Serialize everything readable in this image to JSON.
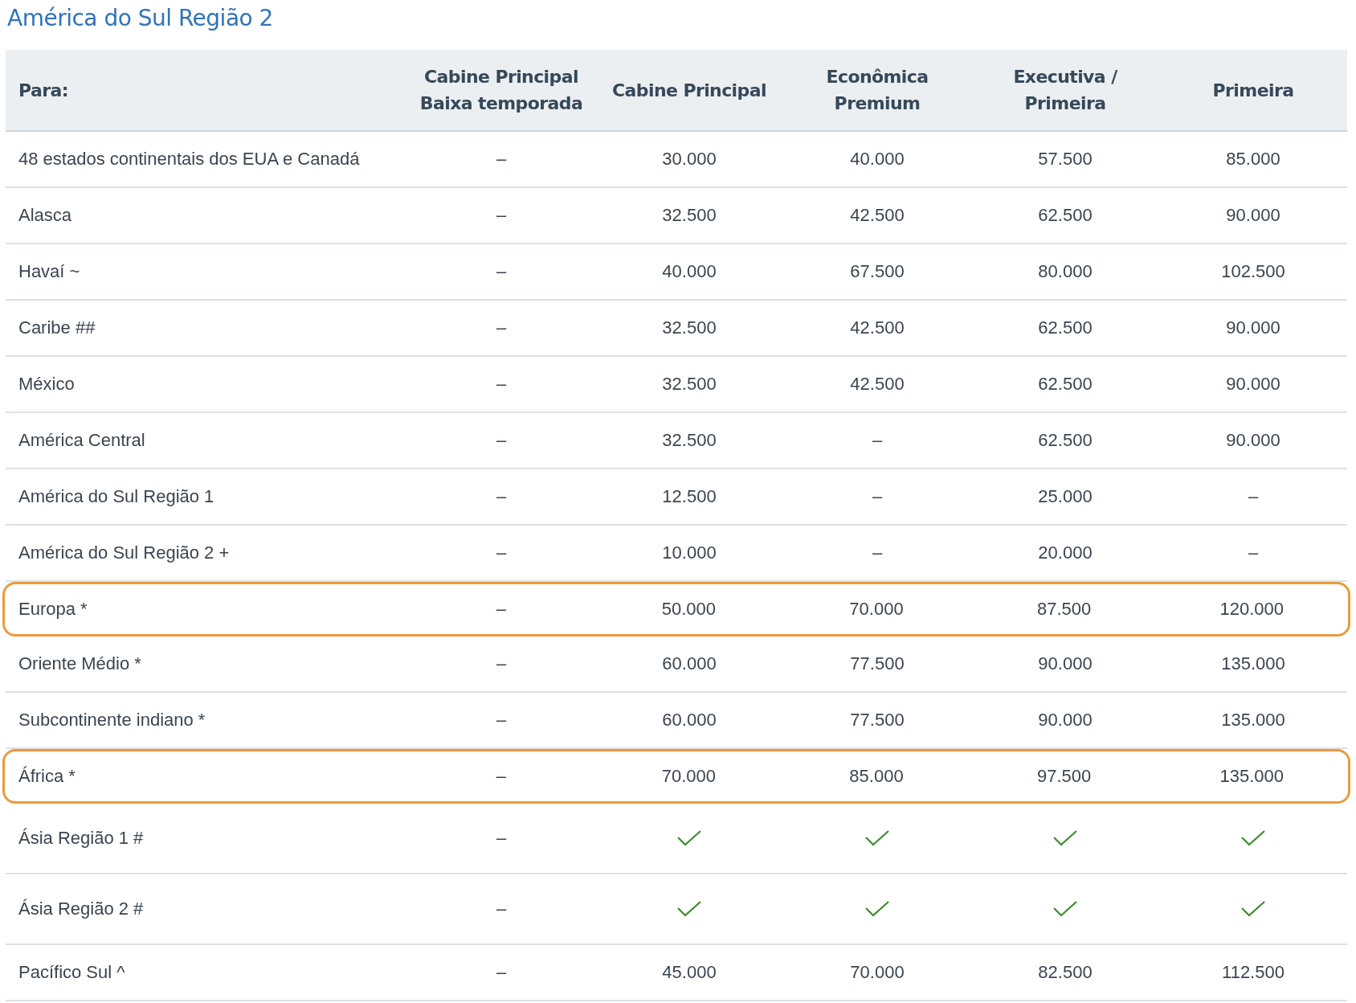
{
  "title": "América do Sul Região 2",
  "table": {
    "columns": [
      "Para:",
      "Cabine Principal\nBaixa temporada",
      "Cabine Principal",
      "Econômica\nPremium",
      "Executiva /\nPrimeira",
      "Primeira"
    ],
    "rows": [
      {
        "highlighted": false,
        "cells": [
          {
            "kind": "text",
            "text": "48 estados continentais dos EUA e Canadá"
          },
          {
            "kind": "text",
            "text": "–"
          },
          {
            "kind": "text",
            "text": "30.000"
          },
          {
            "kind": "text",
            "text": "40.000"
          },
          {
            "kind": "text",
            "text": "57.500"
          },
          {
            "kind": "text",
            "text": "85.000"
          }
        ]
      },
      {
        "highlighted": false,
        "cells": [
          {
            "kind": "text",
            "text": "Alasca"
          },
          {
            "kind": "text",
            "text": "–"
          },
          {
            "kind": "text",
            "text": "32.500"
          },
          {
            "kind": "text",
            "text": "42.500"
          },
          {
            "kind": "text",
            "text": "62.500"
          },
          {
            "kind": "text",
            "text": "90.000"
          }
        ]
      },
      {
        "highlighted": false,
        "cells": [
          {
            "kind": "text",
            "text": "Havaí ~"
          },
          {
            "kind": "text",
            "text": "–"
          },
          {
            "kind": "text",
            "text": "40.000"
          },
          {
            "kind": "text",
            "text": "67.500"
          },
          {
            "kind": "text",
            "text": "80.000"
          },
          {
            "kind": "text",
            "text": "102.500"
          }
        ]
      },
      {
        "highlighted": false,
        "cells": [
          {
            "kind": "text",
            "text": "Caribe ##"
          },
          {
            "kind": "text",
            "text": "–"
          },
          {
            "kind": "text",
            "text": "32.500"
          },
          {
            "kind": "text",
            "text": "42.500"
          },
          {
            "kind": "text",
            "text": "62.500"
          },
          {
            "kind": "text",
            "text": "90.000"
          }
        ]
      },
      {
        "highlighted": false,
        "cells": [
          {
            "kind": "text",
            "text": "México"
          },
          {
            "kind": "text",
            "text": "–"
          },
          {
            "kind": "text",
            "text": "32.500"
          },
          {
            "kind": "text",
            "text": "42.500"
          },
          {
            "kind": "text",
            "text": "62.500"
          },
          {
            "kind": "text",
            "text": "90.000"
          }
        ]
      },
      {
        "highlighted": false,
        "cells": [
          {
            "kind": "text",
            "text": "América Central"
          },
          {
            "kind": "text",
            "text": "–"
          },
          {
            "kind": "text",
            "text": "32.500"
          },
          {
            "kind": "text",
            "text": "–"
          },
          {
            "kind": "text",
            "text": "62.500"
          },
          {
            "kind": "text",
            "text": "90.000"
          }
        ]
      },
      {
        "highlighted": false,
        "cells": [
          {
            "kind": "text",
            "text": "América do Sul Região 1"
          },
          {
            "kind": "text",
            "text": "–"
          },
          {
            "kind": "text",
            "text": "12.500"
          },
          {
            "kind": "text",
            "text": "–"
          },
          {
            "kind": "text",
            "text": "25.000"
          },
          {
            "kind": "text",
            "text": "–"
          }
        ]
      },
      {
        "highlighted": false,
        "cells": [
          {
            "kind": "text",
            "text": "América do Sul Região 2 +"
          },
          {
            "kind": "text",
            "text": "–"
          },
          {
            "kind": "text",
            "text": "10.000"
          },
          {
            "kind": "text",
            "text": "–"
          },
          {
            "kind": "text",
            "text": "20.000"
          },
          {
            "kind": "text",
            "text": "–"
          }
        ]
      },
      {
        "highlighted": true,
        "cells": [
          {
            "kind": "text",
            "text": "Europa *"
          },
          {
            "kind": "text",
            "text": "–"
          },
          {
            "kind": "text",
            "text": "50.000"
          },
          {
            "kind": "text",
            "text": "70.000"
          },
          {
            "kind": "text",
            "text": "87.500"
          },
          {
            "kind": "text",
            "text": "120.000"
          }
        ]
      },
      {
        "highlighted": false,
        "cells": [
          {
            "kind": "text",
            "text": "Oriente Médio *"
          },
          {
            "kind": "text",
            "text": "–"
          },
          {
            "kind": "text",
            "text": "60.000"
          },
          {
            "kind": "text",
            "text": "77.500"
          },
          {
            "kind": "text",
            "text": "90.000"
          },
          {
            "kind": "text",
            "text": "135.000"
          }
        ]
      },
      {
        "highlighted": false,
        "cells": [
          {
            "kind": "text",
            "text": "Subcontinente indiano *"
          },
          {
            "kind": "text",
            "text": "–"
          },
          {
            "kind": "text",
            "text": "60.000"
          },
          {
            "kind": "text",
            "text": "77.500"
          },
          {
            "kind": "text",
            "text": "90.000"
          },
          {
            "kind": "text",
            "text": "135.000"
          }
        ]
      },
      {
        "highlighted": true,
        "cells": [
          {
            "kind": "text",
            "text": "África *"
          },
          {
            "kind": "text",
            "text": "–"
          },
          {
            "kind": "text",
            "text": "70.000"
          },
          {
            "kind": "text",
            "text": "85.000"
          },
          {
            "kind": "text",
            "text": "97.500"
          },
          {
            "kind": "text",
            "text": "135.000"
          }
        ]
      },
      {
        "highlighted": false,
        "cells": [
          {
            "kind": "text",
            "text": "Ásia Região 1 #"
          },
          {
            "kind": "text",
            "text": "–"
          },
          {
            "kind": "check"
          },
          {
            "kind": "check"
          },
          {
            "kind": "check"
          },
          {
            "kind": "check"
          }
        ]
      },
      {
        "highlighted": false,
        "cells": [
          {
            "kind": "text",
            "text": "Ásia Região 2 #"
          },
          {
            "kind": "text",
            "text": "–"
          },
          {
            "kind": "check"
          },
          {
            "kind": "check"
          },
          {
            "kind": "check"
          },
          {
            "kind": "check"
          }
        ]
      },
      {
        "highlighted": false,
        "cells": [
          {
            "kind": "text",
            "text": "Pacífico Sul ^"
          },
          {
            "kind": "text",
            "text": "–"
          },
          {
            "kind": "text",
            "text": "45.000"
          },
          {
            "kind": "text",
            "text": "70.000"
          },
          {
            "kind": "text",
            "text": "82.500"
          },
          {
            "kind": "text",
            "text": "112.500"
          }
        ]
      }
    ]
  }
}
